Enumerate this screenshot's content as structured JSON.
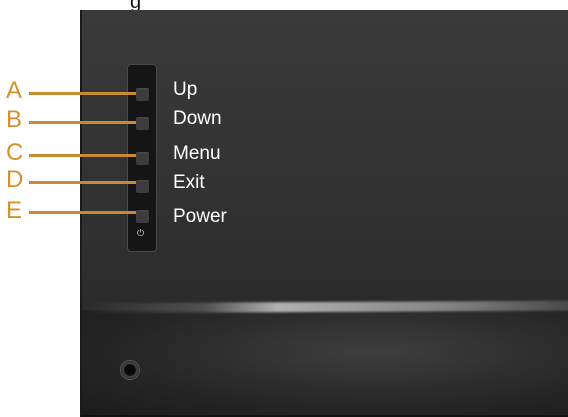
{
  "header": {
    "partial_text": "g"
  },
  "buttons": [
    {
      "letter": "A",
      "label": "Up"
    },
    {
      "letter": "B",
      "label": "Down"
    },
    {
      "letter": "C",
      "label": "Menu"
    },
    {
      "letter": "D",
      "label": "Exit"
    },
    {
      "letter": "E",
      "label": "Power"
    }
  ],
  "power_symbol": "⏻",
  "colors": {
    "callout": "#d4912e",
    "bezel": "#333333",
    "label_text": "#ffffff"
  }
}
